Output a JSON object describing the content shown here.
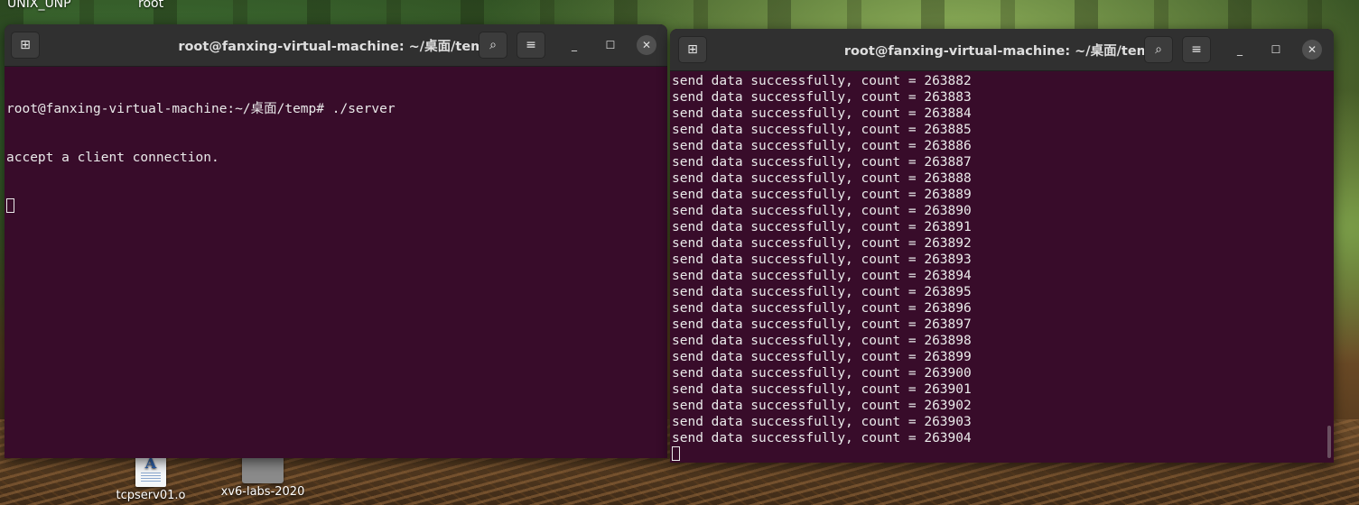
{
  "desktop": {
    "top_labels": [
      "UNIX_UNP",
      "root"
    ],
    "icons": [
      {
        "label": "tcpserv01.o",
        "icon": "document-icon",
        "glyph": "A"
      },
      {
        "label": "xv6-labs-2020",
        "icon": "folder-icon"
      }
    ]
  },
  "left_terminal": {
    "title": "root@fanxing-virtual-machine: ~/桌面/temp",
    "new_tab_icon": "⊞",
    "search_icon": "⌕",
    "menu_icon": "≡",
    "minimize": "_",
    "maximize": "☐",
    "close": "✕",
    "lines": [
      "root@fanxing-virtual-machine:~/桌面/temp# ./server",
      "accept a client connection."
    ]
  },
  "right_terminal": {
    "title": "root@fanxing-virtual-machine: ~/桌面/temp",
    "new_tab_icon": "⊞",
    "search_icon": "⌕",
    "menu_icon": "≡",
    "minimize": "_",
    "maximize": "☐",
    "close": "✕",
    "lines": [
      "send data successfully, count = 263882",
      "send data successfully, count = 263883",
      "send data successfully, count = 263884",
      "send data successfully, count = 263885",
      "send data successfully, count = 263886",
      "send data successfully, count = 263887",
      "send data successfully, count = 263888",
      "send data successfully, count = 263889",
      "send data successfully, count = 263890",
      "send data successfully, count = 263891",
      "send data successfully, count = 263892",
      "send data successfully, count = 263893",
      "send data successfully, count = 263894",
      "send data successfully, count = 263895",
      "send data successfully, count = 263896",
      "send data successfully, count = 263897",
      "send data successfully, count = 263898",
      "send data successfully, count = 263899",
      "send data successfully, count = 263900",
      "send data successfully, count = 263901",
      "send data successfully, count = 263902",
      "send data successfully, count = 263903",
      "send data successfully, count = 263904"
    ]
  },
  "colors": {
    "terminal_bg": "#380c2a",
    "titlebar_bg": "#303030",
    "text": "#eaeaea"
  }
}
